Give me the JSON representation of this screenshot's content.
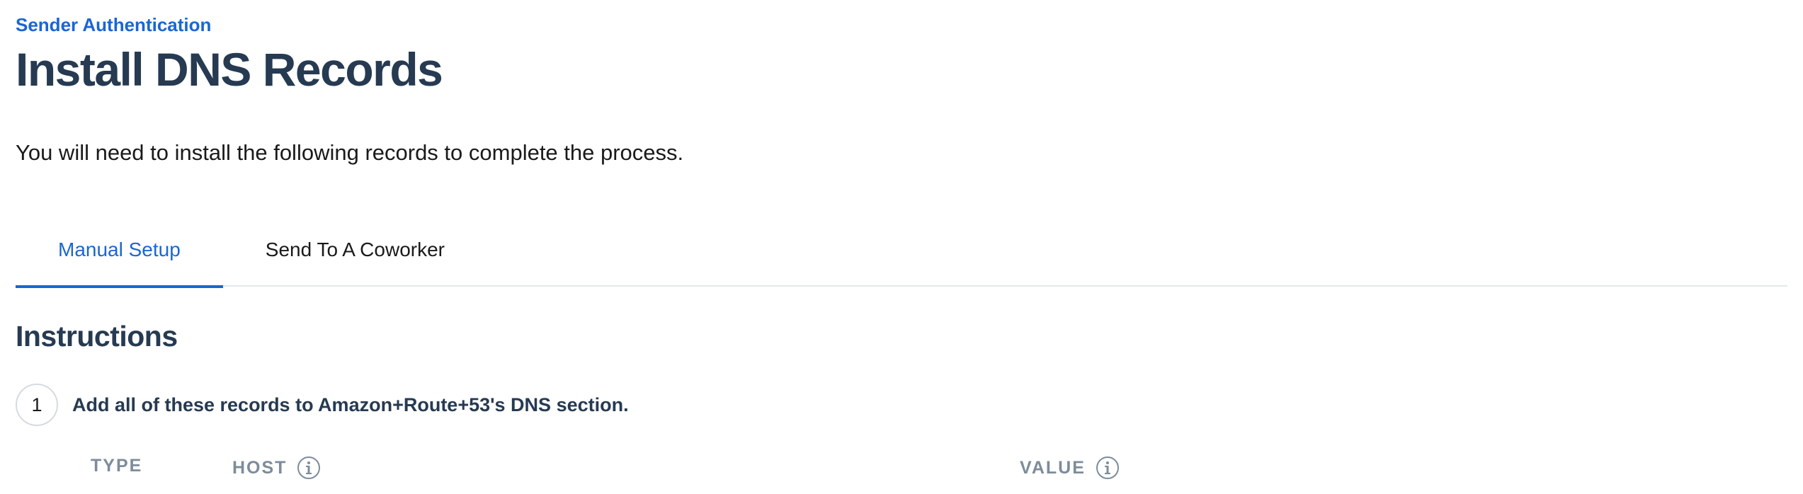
{
  "header": {
    "eyebrow": "Sender Authentication",
    "title": "Install DNS Records",
    "subtitle": "You will need to install the following records to complete the process."
  },
  "tabs": [
    {
      "label": "Manual Setup",
      "active": true
    },
    {
      "label": "Send To A Coworker",
      "active": false
    }
  ],
  "instructions": {
    "title": "Instructions",
    "steps": [
      {
        "number": "1",
        "text": "Add all of these records to Amazon+Route+53's DNS section."
      }
    ]
  },
  "table": {
    "columns": [
      {
        "label": "TYPE",
        "info_icon": false
      },
      {
        "label": "HOST",
        "info_icon": true
      },
      {
        "label": "VALUE",
        "info_icon": true
      }
    ]
  },
  "colors": {
    "accent": "#1a66d4",
    "heading": "#263a52",
    "muted": "#7d8c9a"
  }
}
